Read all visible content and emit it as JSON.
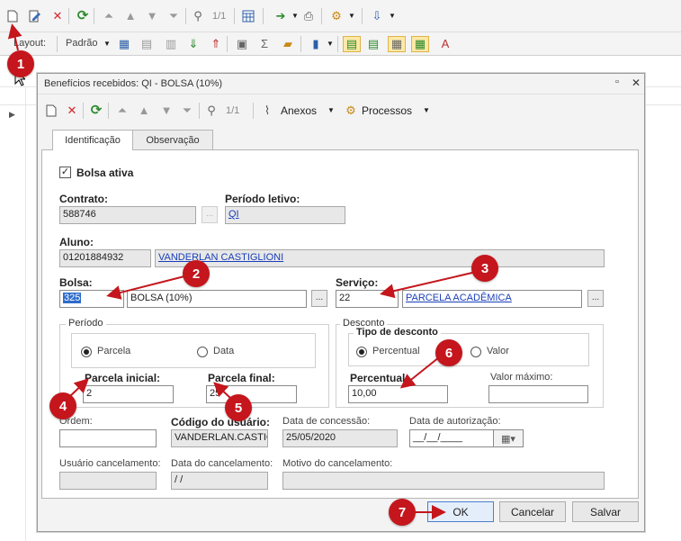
{
  "app": {
    "toolbar": {
      "page_counter": "1/1"
    },
    "toolbar2": {
      "layout_label": "Layout:",
      "layout_value": "Padrão"
    }
  },
  "dialog": {
    "title": "Benefícios recebidos: QI - BOLSA (10%)",
    "toolbar": {
      "page_counter": "1/1",
      "attachments_label": "Anexos",
      "processes_label": "Processos"
    },
    "tabs": [
      {
        "label": "Identificação",
        "active": true
      },
      {
        "label": "Observação",
        "active": false
      }
    ],
    "form": {
      "active_checkbox": {
        "label": "Bolsa ativa",
        "checked": true
      },
      "contract": {
        "label": "Contrato:",
        "value": "588746"
      },
      "school_period": {
        "label": "Período letivo:",
        "value": "QI"
      },
      "student": {
        "label": "Aluno:",
        "code": "01201884932",
        "name": "VANDERLAN CASTIGLIONI"
      },
      "scholarship": {
        "label": "Bolsa:",
        "code": "325",
        "name": "BOLSA (10%)"
      },
      "service": {
        "label": "Serviço:",
        "code": "22",
        "name": "PARCELA ACADÊMICA"
      },
      "period_group": {
        "legend": "Período",
        "option_installment": "Parcela",
        "option_date": "Data",
        "selected": "Parcela",
        "first_installment": {
          "label": "Parcela inicial:",
          "value": "2"
        },
        "last_installment": {
          "label": "Parcela final:",
          "value": "25"
        }
      },
      "discount_group": {
        "legend": "Desconto",
        "type_legend": "Tipo de desconto",
        "option_percent": "Percentual",
        "option_value": "Valor",
        "selected": "Percentual",
        "percent": {
          "label": "Percentual:",
          "value": "10,00"
        },
        "max_value": {
          "label": "Valor máximo:",
          "value": ""
        }
      },
      "order": {
        "label": "Ordem:",
        "value": ""
      },
      "user_code": {
        "label": "Código do usuário:",
        "value": "VANDERLAN.CASTIG"
      },
      "grant_date": {
        "label": "Data de concessão:",
        "value": "25/05/2020"
      },
      "auth_date": {
        "label": "Data de autorização:",
        "value": "__/__/____"
      },
      "cancel_user": {
        "label": "Usuário cancelamento:",
        "value": ""
      },
      "cancel_date": {
        "label": "Data do cancelamento:",
        "value": "/ /"
      },
      "cancel_reason": {
        "label": "Motivo do cancelamento:",
        "value": ""
      }
    },
    "buttons": {
      "ok": "OK",
      "cancel": "Cancelar",
      "save": "Salvar"
    }
  },
  "annotations": [
    "1",
    "2",
    "3",
    "4",
    "5",
    "6",
    "7"
  ],
  "colors": {
    "annotation": "#c4161c",
    "link": "#1a3fb8",
    "selection": "#2f6ccc"
  }
}
